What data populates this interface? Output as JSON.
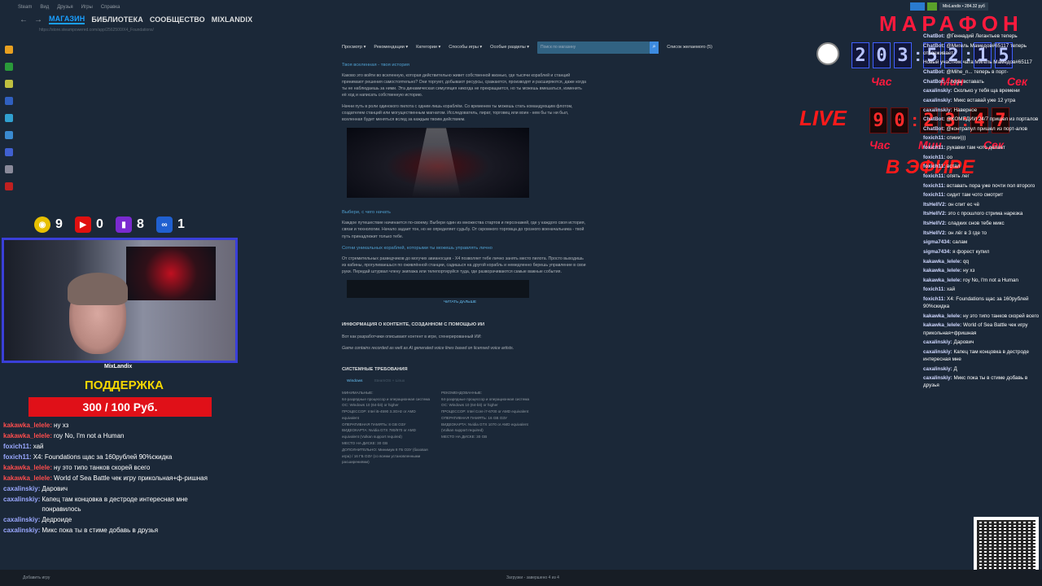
{
  "steam": {
    "menu": [
      "Steam",
      "Вид",
      "Друзья",
      "Игры",
      "Справка"
    ],
    "tabs": [
      "МАГАЗИН",
      "БИБЛИОТЕКА",
      "СООБЩЕСТВО",
      "MIXLANDIX"
    ],
    "url": "https://store.steampowered.com/app/2562500/X4_Foundations/",
    "account": "MixLandix • 284.32 руб"
  },
  "store": {
    "nav": [
      "Просмотр ▾",
      "Рекомендации ▾",
      "Категории ▾",
      "Способы игры ▾",
      "Особые разделы ▾"
    ],
    "search_placeholder": "Поиск по магазину",
    "wishlist": "Список желаемого (5)",
    "sec1_title": "Твоя вселенная - твоя история",
    "p1": "Каково это войти во вселенную, которая действительно живет собственной жизнью, где тысячи кораблей и станций принимают решения самостоятельно? Они торгуют, добывают ресурсы, сражаются, производят и расширяются, даже когда ты не наблюдаешь за ними. Эта динамическая симуляция никогда не прекращается, но ты можешь вмешаться, изменить её ход и написать собственную историю.",
    "p2": "Начни путь в роли одинокого пилота с одним лишь кораблём. Со временем ты можешь стать командующим флотом, создателем станций или могущественным магнатом. Исследователь, пират, торговец или воин - кем бы ты ни был, вселенная будет меняться вслед за каждым твоим действием.",
    "sec2_title": "Выбери, с чего начать",
    "p3": "Каждое путешествие начинается по-своему. Выбери один из множества стартов и персонажей, где у каждого своя история, связи и технологии. Начало задает тон, но не определяет судьбу. От скромного торговца до грозного военачальника - твой путь принадлежит только тебе.",
    "sec3_title": "Сотни уникальных кораблей, которыми ты можешь управлять лично",
    "p4": "От стремительных разведчиков до могучих авианосцев - X4 позволяет тебе лично занять место пилота. Просто выходишь из кабины, прогуливаешься по оживлённой станции, садишься на другой корабль и немедленно берешь управление в свои руки. Передай штурвал члену экипажа или телепортируйся туда, где разворачиваются самые важные события.",
    "read_more": "ЧИТАТЬ ДАЛЬШЕ",
    "ai_title": "ИНФОРМАЦИЯ О КОНТЕНТЕ, СОЗДАННОМ С ПОМОЩЬЮ ИИ",
    "ai_p1": "Вот как разработчики описывают контент в игре, сгенерированный ИИ:",
    "ai_p2": "Game contains recorded as well as AI generated voice lines based on licensed voice artists.",
    "req_title": "СИСТЕМНЫЕ ТРЕБОВАНИЯ",
    "req_tabs": [
      "Windows",
      "SteamOS + Linux"
    ],
    "min": [
      "МИНИМАЛЬНЫЕ:",
      "64-разрядные процессор и операционная система",
      "ОС: Windows 10 (64-bit) or higher",
      "ПРОЦЕССОР: Intel i5-4590 3.3GHz or AMD equivalent",
      "ОПЕРАТИВНАЯ ПАМЯТЬ: 8 GB ОЗУ",
      "ВИДЕОКАРТА: Nvidia GTX 780/970 or AMD equivalent (Vulkan support required)",
      "МЕСТО НА ДИСКЕ: 30 GB",
      "ДОПОЛНИТЕЛЬНО: Минимум 8 ГБ ОЗУ (базовая игра) / 16 ГБ ОЗУ (со всеми установленными расширениями)"
    ],
    "rec": [
      "РЕКОМЕНДОВАННЫЕ:",
      "64-разрядные процессор и операционная система",
      "ОС: Windows 10 (64-bit) or higher",
      "ПРОЦЕССОР: Intel Core i7-6700 or AMD equivalent",
      "ОПЕРАТИВНАЯ ПАМЯТЬ: 16 GB ОЗУ",
      "ВИДЕОКАРТА: Nvidia GTX 1070 or AMD equivalent (Vulkan support required)",
      "МЕСТО НА ДИСКЕ: 30 GB"
    ]
  },
  "footer": {
    "add_game": "Добавить игру",
    "downloads": "Загрузки - завершено 4 из 4"
  },
  "stats": {
    "views": "9",
    "youtube": "0",
    "twitch": "8",
    "vk": "1"
  },
  "cam_name": "MixLandix",
  "support": {
    "title": "ПОДДЕРЖКА",
    "amount": "300 / 100 Руб."
  },
  "chat_left": [
    {
      "user": "kakawka_lelele:",
      "text": "ну хз",
      "color": "#ff4d4d"
    },
    {
      "user": "kakawka_lelele:",
      "text": "roy No, I'm not a Human",
      "color": "#ff4d4d"
    },
    {
      "user": "foxich11:",
      "text": "хай",
      "color": "#9aa8ff"
    },
    {
      "user": "foxich11:",
      "text": "X4: Foundations щас за 160рублей 90%скидка",
      "color": "#9aa8ff"
    },
    {
      "user": "kakawka_lelele:",
      "text": "ну это типо танков скорей всего",
      "color": "#ff4d4d"
    },
    {
      "user": "kakawka_lelele:",
      "text": "World of Sea Battle чек игру прикольная+ф-ришная",
      "color": "#ff4d4d"
    },
    {
      "user": "caxalinskiy:",
      "text": "Дарович",
      "color": "#9aa8ff"
    },
    {
      "user": "caxalinskiy:",
      "text": "Капец там концовка в дестроде интересная мне понравилось",
      "color": "#9aa8ff"
    },
    {
      "user": "caxalinskiy:",
      "text": "Дедроиде",
      "color": "#9aa8ff"
    },
    {
      "user": "caxalinskiy:",
      "text": "Микс пока ты в стиме добавь в друзья",
      "color": "#9aa8ff"
    }
  ],
  "marathon": {
    "title": "МАРАФОН",
    "timer1": [
      "2",
      "0",
      "3",
      ":",
      "5",
      "2",
      ":",
      "1",
      "5"
    ],
    "timer2": [
      "9",
      "0",
      ":",
      "2",
      "3",
      ":",
      "4",
      "7"
    ],
    "units": [
      "Час",
      "Мин",
      "Сек"
    ],
    "live": "LIVE",
    "on_air": "В ЭФИРЕ"
  },
  "chat_right": [
    {
      "user": "ChatBot:",
      "text": "@Геннадий Легантьев теперь"
    },
    {
      "user": "ChatBot:",
      "text": "@Мигель Мамедов#65117 теперь отслеживает"
    },
    {
      "user": "",
      "text": "Новый участник чата Мигель Мамедов#65117"
    },
    {
      "user": "ChatBot:",
      "text": "@Mihe_n... теперь в порт-"
    },
    {
      "user": "ChatBot:",
      "text": "...пора вставать"
    },
    {
      "user": "caxalinskiy:",
      "text": "Сколько у тебя ща времени"
    },
    {
      "user": "caxalinskiy:",
      "text": "Микс вставай уже 12 утра"
    },
    {
      "user": "caxalinskiy:",
      "text": "Наверное"
    },
    {
      "user": "ChatBot:",
      "text": "@КОМЕДИИ 24/7 пришел из порталов"
    },
    {
      "user": "ChatBot:",
      "text": "@контрапул пришел из порт-алов"
    },
    {
      "user": "foxich11:",
      "text": "спиии)))"
    },
    {
      "user": "foxich11:",
      "text": "рукавки там чото делает"
    },
    {
      "user": "foxich11:",
      "text": "оо"
    },
    {
      "user": "foxich11:",
      "text": "встал"
    },
    {
      "user": "foxich11:",
      "text": "опять лег"
    },
    {
      "user": "foxich11:",
      "text": "вставать пора уже почти пол второго"
    },
    {
      "user": "foxich11:",
      "text": "сидит там чото смотрит"
    },
    {
      "user": "ItsHellV2:",
      "text": "он спит ес чё"
    },
    {
      "user": "ItsHellV2:",
      "text": "это с прошлого стрима нарезка"
    },
    {
      "user": "ItsHellV2:",
      "text": "сладких снов тебе микс"
    },
    {
      "user": "ItsHellV2:",
      "text": "он лёг в 3 где то"
    },
    {
      "user": "sigma7434:",
      "text": "салам"
    },
    {
      "user": "sigma7434:",
      "text": "я форест купил"
    },
    {
      "user": "kakawka_lelele:",
      "text": "qq"
    },
    {
      "user": "kakawka_lelele:",
      "text": "ну хз"
    },
    {
      "user": "kakawka_lelele:",
      "text": "roy No, I'm not a Human"
    },
    {
      "user": "foxich11:",
      "text": "хай"
    },
    {
      "user": "foxich11:",
      "text": "X4: Foundations щас за 160рублей 90%скидка"
    },
    {
      "user": "kakawka_lelele:",
      "text": "ну это типо танков скорей всего"
    },
    {
      "user": "kakawka_lelele:",
      "text": "World of Sea Battle чек игру прикольная+фришная"
    },
    {
      "user": "caxalinskiy:",
      "text": "Дарович"
    },
    {
      "user": "caxalinskiy:",
      "text": "Капец там концовка в дестроде интересная мне"
    },
    {
      "user": "caxalinskiy:",
      "text": "Д"
    },
    {
      "user": "caxalinskiy:",
      "text": "Микс пока ты в стиме добавь в друзья"
    }
  ]
}
